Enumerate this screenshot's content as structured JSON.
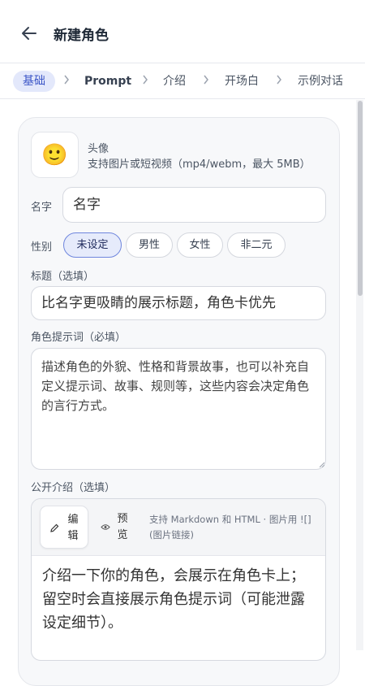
{
  "header": {
    "title": "新建角色",
    "back_icon": "arrow-left-icon"
  },
  "steps": [
    {
      "label": "基础",
      "active": true
    },
    {
      "label": "Prompt",
      "active": false
    },
    {
      "label": "介绍",
      "active": false
    },
    {
      "label": "开场白",
      "active": false
    },
    {
      "label": "示例对话",
      "active": false
    }
  ],
  "avatar": {
    "emoji": "🙂",
    "label": "头像",
    "hint": "支持图片或短视频（mp4/webm，最大 5MB）"
  },
  "name": {
    "label": "名字",
    "placeholder": "名字"
  },
  "gender": {
    "label": "性别",
    "options": [
      "未设定",
      "男性",
      "女性",
      "非二元"
    ],
    "selected": "未设定"
  },
  "display_title": {
    "label": "标题（选填）",
    "placeholder": "比名字更吸睛的展示标题，角色卡优先"
  },
  "role_prompt": {
    "label": "角色提示词（必填）",
    "placeholder": "描述角色的外貌、性格和背景故事，也可以补充自定义提示词、故事、规则等，这些内容会决定角色的言行方式。"
  },
  "public_intro": {
    "label": "公开介绍（选填）",
    "edit_tab": [
      "编",
      "辑"
    ],
    "preview_tab": [
      "预",
      "览"
    ],
    "hint": "支持 Markdown 和 HTML · 图片用 ![](图片链接)",
    "placeholder": "介绍一下你的角色，会展示在角色卡上；留空时会直接展示角色提示词（可能泄露设定细节）。"
  },
  "colors": {
    "accent": "#3b55c7",
    "accent_bg": "#e3e8fb",
    "card_bg": "#f7f8fa"
  }
}
